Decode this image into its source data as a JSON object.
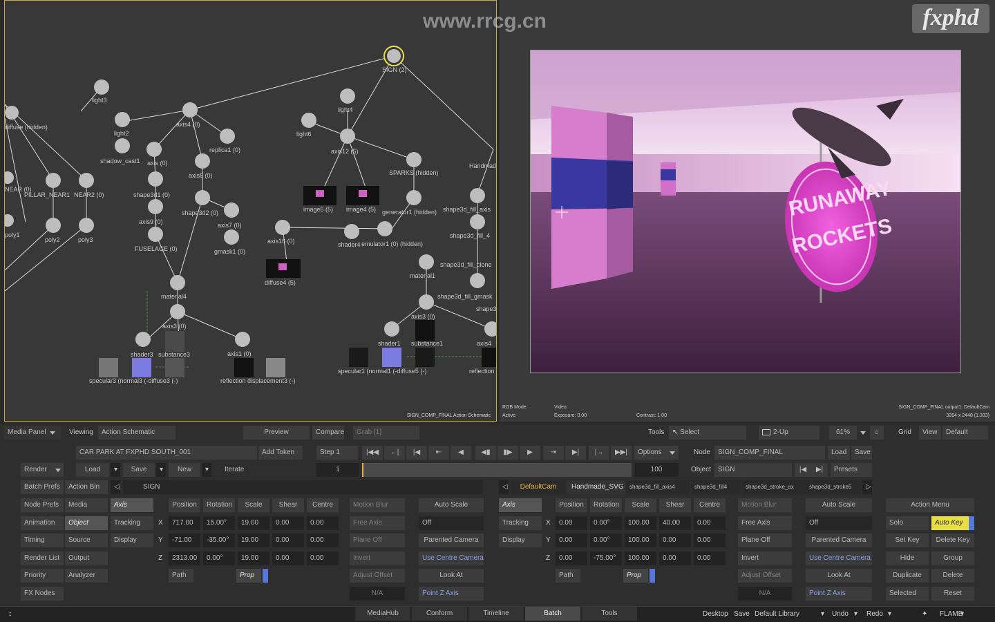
{
  "watermark": "www.rrcg.cn",
  "logo": "fxphd",
  "schematic": {
    "footer": "SIGN_COMP_FINAL Action Schematic",
    "nodes": [
      {
        "tag": "Axis",
        "label": "SIGN (2)"
      },
      {
        "tag": "Light",
        "label": "light3"
      },
      {
        "tag": "Light",
        "label": "light2"
      },
      {
        "tag": "Light",
        "label": "light4"
      },
      {
        "tag": "Light",
        "label": "light6"
      },
      {
        "tag": "Light",
        "label": "SPARKS (hidden)"
      },
      {
        "tag": "Axis",
        "label": "axis4 (0)"
      },
      {
        "tag": "Replica",
        "label": "replica1 (0)"
      },
      {
        "tag": "Axis",
        "label": "axis12 (5)"
      },
      {
        "tag": "Shadow",
        "label": "shadow_cast1"
      },
      {
        "tag": "Axis",
        "label": "axis (0)"
      },
      {
        "tag": "Axis",
        "label": "axis8 (0)"
      },
      {
        "tag": "3D",
        "label": "shape3d1 (0)"
      },
      {
        "tag": "3D",
        "label": "shape3d2 (0)"
      },
      {
        "tag": "Axis",
        "label": "axis9 (0)"
      },
      {
        "tag": "Axis",
        "label": "axis7 (0)"
      },
      {
        "tag": "GMask",
        "label": "FUSELAGE (0)"
      },
      {
        "tag": "GMask",
        "label": "gmask1 (0)"
      },
      {
        "tag": "Image",
        "label": "image5 (5)"
      },
      {
        "tag": "Image",
        "label": "image4 (5)"
      },
      {
        "tag": "Particle",
        "label": "generator1 (hidden)"
      },
      {
        "tag": "Shader",
        "label": "shader4"
      },
      {
        "tag": "Particle",
        "label": "emulator1 (0) (hidden)"
      },
      {
        "tag": "Axis",
        "label": "axis16 (0)"
      },
      {
        "tag": "Image",
        "label": "diffuse4 (5)"
      },
      {
        "tag": "Material",
        "label": "material1"
      },
      {
        "tag": "Material",
        "label": "material4"
      },
      {
        "tag": "Axis",
        "label": "axis3 (0)"
      },
      {
        "tag": "Axis",
        "label": "axis1 (0)"
      },
      {
        "tag": "Axis",
        "label": "axis3 (0)"
      },
      {
        "tag": "Shader",
        "label": "shader3"
      },
      {
        "tag": "Shader",
        "label": "shader1"
      },
      {
        "tag": "Axis",
        "label": "axis4"
      },
      {
        "tag": "Save",
        "label": "poly2"
      },
      {
        "tag": "Save",
        "label": "poly3"
      },
      {
        "tag": "Axis",
        "label": "PILLAR_NEAR1"
      },
      {
        "tag": "Axis",
        "label": "NEAR2 (0)"
      }
    ],
    "texts": [
      "diffuse (hidden)",
      "NEAR (0)",
      "poly1",
      "Handmade",
      "shape3d_fill_axis",
      "shape3d_fill_4",
      "shape3d_fill_clone",
      "shape3d_fill_gmask",
      "shape3",
      "reflection",
      "substance1",
      "specular1 (normal1 (-diffuse5 (-)",
      "specular3 (normal3 (-diffuse3 (-)",
      "substance3",
      "reflection displacement3 (-)"
    ]
  },
  "viewer": {
    "rgb_mode": "RGB Mode",
    "rgb_mode_value": "Active",
    "video_label": "Video",
    "exposure": "Exposure: 0.00",
    "contrast": "Contrast: 1.00",
    "output_info": "SIGN_COMP_FINAL output1: DefaultCam",
    "resolution": "3264 x 2448 (1.333)",
    "sign_text_1": "RUNAWAY",
    "sign_text_2": "ROCKETS"
  },
  "toolbar": {
    "media_panel": "Media Panel",
    "viewing_label": "Viewing",
    "viewing_value": "Action Schematic",
    "preview": "Preview",
    "compare": "Compare",
    "grab": "Grab [1]",
    "tools_label": "Tools",
    "select": "Select",
    "two_up": "2-Up",
    "zoom": "61%",
    "grid": "Grid",
    "view": "View",
    "default": "Default"
  },
  "controls": {
    "clip_name": "CAR PARK AT FXPHD SOUTH_001",
    "add_token": "Add Token",
    "step": "Step 1",
    "options": "Options",
    "node_label": "Node",
    "node_value": "SIGN_COMP_FINAL",
    "load": "Load",
    "save": "Save",
    "object_label": "Object",
    "object_value": "SIGN",
    "presets": "Presets",
    "render": "Render",
    "load2": "Load",
    "save2": "Save",
    "new": "New",
    "iterate": "Iterate",
    "frame": "1",
    "frame_end": "100",
    "batch_prefs": "Batch Prefs",
    "action_bin": "Action Bin",
    "sign": "SIGN",
    "node_prefs": "Node Prefs",
    "media": "Media",
    "axis_tab": "Axis",
    "animation": "Animation",
    "object_tab": "Object",
    "tracking": "Tracking",
    "timing": "Timing",
    "source": "Source",
    "display": "Display",
    "render_list": "Render List",
    "output": "Output",
    "priority": "Priority",
    "analyzer": "Analyzer",
    "fx_nodes": "FX Nodes"
  },
  "axis_left": {
    "headers": [
      "Position",
      "Rotation",
      "Scale",
      "Shear",
      "Centre"
    ],
    "rows": [
      {
        "axis": "X",
        "values": [
          "717.00",
          "15.00°",
          "19.00",
          "0.00",
          "0.00"
        ]
      },
      {
        "axis": "Y",
        "values": [
          "-71.00",
          "-35.00°",
          "19.00",
          "0.00",
          "0.00"
        ]
      },
      {
        "axis": "Z",
        "values": [
          "2313.00",
          "0.00°",
          "19.00",
          "0.00",
          "0.00"
        ]
      }
    ],
    "path": "Path",
    "prop": "Prop",
    "motion_blur": "Motion Blur",
    "free_axis": "Free Axis",
    "plane_off": "Plane Off",
    "invert": "Invert",
    "adjust_offset": "Adjust Offset",
    "na": "N/A",
    "auto_scale": "Auto Scale",
    "off": "Off",
    "parented_camera": "Parented Camera",
    "use_centre_camera": "Use Centre Camera",
    "look_at": "Look At",
    "point_z_axis": "Point Z Axis"
  },
  "cam_tabs": [
    "DefaultCam",
    "Handmade_SVG",
    "shape3d_fill_axis4",
    "shape3d_fill4",
    "shape3d_stroke_ax",
    "shape3d_stroke5"
  ],
  "axis_right": {
    "axis_tab": "Axis",
    "tracking": "Tracking",
    "display": "Display",
    "headers": [
      "Position",
      "Rotation",
      "Scale",
      "Shear",
      "Centre"
    ],
    "rows": [
      {
        "axis": "X",
        "values": [
          "0.00",
          "0.00°",
          "100.00",
          "40.00",
          "0.00"
        ]
      },
      {
        "axis": "Y",
        "values": [
          "0.00",
          "0.00°",
          "100.00",
          "0.00",
          "0.00"
        ]
      },
      {
        "axis": "Z",
        "values": [
          "0.00",
          "-75.00°",
          "100.00",
          "0.00",
          "0.00"
        ]
      }
    ],
    "path": "Path",
    "prop": "Prop",
    "motion_blur": "Motion Blur",
    "free_axis": "Free Axis",
    "plane_off": "Plane Off",
    "invert": "Invert",
    "adjust_offset": "Adjust Offset",
    "na": "N/A",
    "auto_scale": "Auto Scale",
    "off": "Off",
    "parented_camera": "Parented Camera",
    "use_centre_camera": "Use Centre Camera",
    "look_at": "Look At",
    "point_z_axis": "Point Z Axis"
  },
  "action_menu": {
    "title": "Action Menu",
    "solo": "Solo",
    "auto_key": "Auto Key",
    "set_key": "Set Key",
    "delete_key": "Delete Key",
    "hide": "Hide",
    "group": "Group",
    "duplicate": "Duplicate",
    "delete": "Delete",
    "selected": "Selected",
    "reset": "Reset"
  },
  "bottom": {
    "tabs": [
      "MediaHub",
      "Conform",
      "Timeline",
      "Batch",
      "Tools"
    ],
    "active_tab": "Batch",
    "desktop": "Desktop",
    "save": "Save",
    "default_library": "Default Library",
    "undo": "Undo",
    "redo": "Redo",
    "flame": "FLAME"
  },
  "colors": {
    "accent_yellow": "#e8e040",
    "cam_orange": "#e8b238",
    "prop_blue": "#5878d8",
    "schematic_border": "#c9a84a",
    "render_magenta": "#b040a8"
  }
}
